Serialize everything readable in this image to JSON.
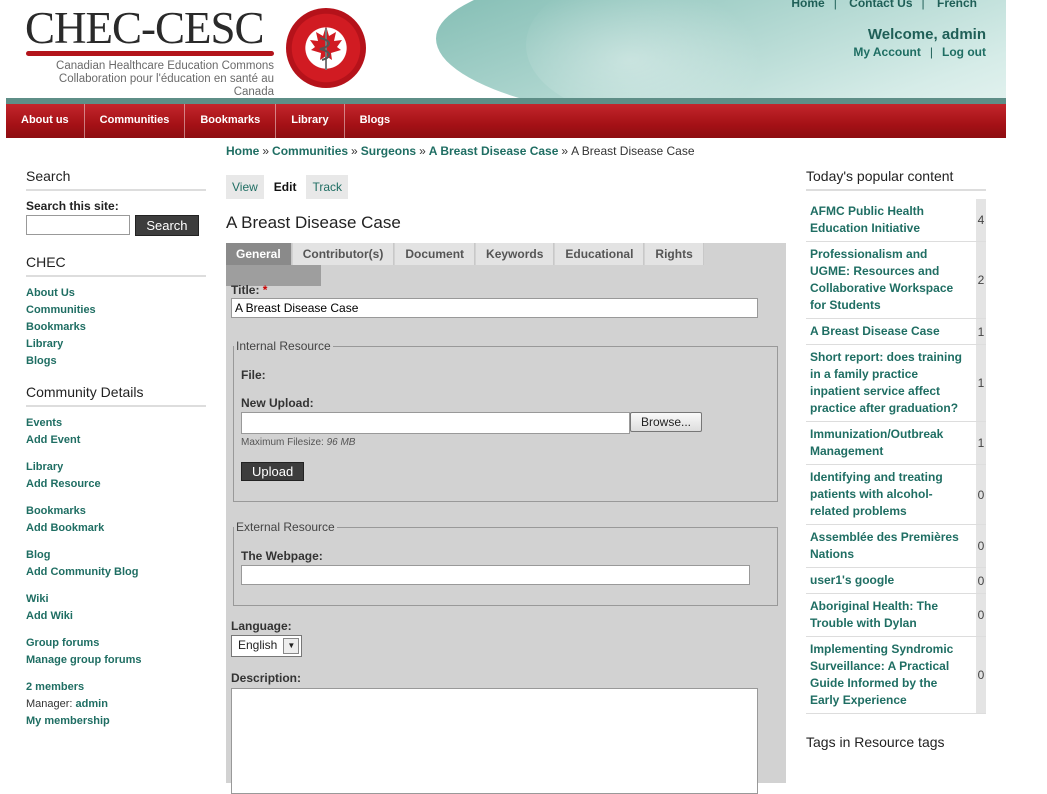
{
  "header": {
    "logo_text": "CHEC-CESC",
    "logo_sub_en": "Canadian Healthcare Education Commons",
    "logo_sub_fr": "Collaboration pour l'éducation en santé au Canada",
    "top_links": [
      "Home",
      "Contact Us",
      "French"
    ],
    "welcome": "Welcome, admin",
    "my_account": "My Account",
    "logout": "Log out"
  },
  "nav": [
    "About us",
    "Communities",
    "Bookmarks",
    "Library",
    "Blogs"
  ],
  "search": {
    "title": "Search",
    "label": "Search this site:",
    "value": "",
    "button": "Search"
  },
  "chec": {
    "title": "CHEC",
    "links": [
      "About Us",
      "Communities",
      "Bookmarks",
      "Library",
      "Blogs"
    ]
  },
  "community": {
    "title": "Community Details",
    "groups": [
      [
        "Events",
        "Add Event"
      ],
      [
        "Library",
        "Add Resource"
      ],
      [
        "Bookmarks",
        "Add Bookmark"
      ],
      [
        "Blog",
        "Add Community Blog"
      ],
      [
        "Wiki",
        "Add Wiki"
      ],
      [
        "Group forums",
        "Manage group forums"
      ]
    ],
    "members": "2 members",
    "manager_label": "Manager:",
    "manager_name": "admin",
    "membership": "My membership"
  },
  "breadcrumb": {
    "items": [
      "Home",
      "Communities",
      "Surgeons",
      "A Breast Disease Case"
    ],
    "current": "A Breast Disease Case",
    "sep": "»"
  },
  "tabs": [
    "View",
    "Edit",
    "Track"
  ],
  "active_tab": "Edit",
  "page_title": "A Breast Disease Case",
  "form": {
    "tabs": [
      "General",
      "Contributor(s)",
      "Document",
      "Keywords",
      "Educational",
      "Rights"
    ],
    "active": "General",
    "title_label": "Title:",
    "required_mark": "*",
    "title_value": "A Breast Disease Case",
    "internal_legend": "Internal Resource",
    "file_label": "File:",
    "new_upload_label": "New Upload:",
    "browse": "Browse...",
    "max_label": "Maximum Filesize:",
    "max_value": "96 MB",
    "upload": "Upload",
    "external_legend": "External Resource",
    "webpage_label": "The Webpage:",
    "webpage_value": "",
    "language_label": "Language:",
    "language_value": "English",
    "description_label": "Description:",
    "description_value": ""
  },
  "popular": {
    "title": "Today's popular content",
    "items": [
      {
        "title": "AFMC Public Health Education Initiative",
        "count": "4"
      },
      {
        "title": "Professionalism and UGME: Resources and Collaborative Workspace for Students",
        "count": "2"
      },
      {
        "title": "A Breast Disease Case",
        "count": "1"
      },
      {
        "title": "Short report: does training in a family practice inpatient service affect practice after graduation?",
        "count": "1"
      },
      {
        "title": "Immunization/Outbreak Management",
        "count": "1"
      },
      {
        "title": "Identifying and treating patients with alcohol-related problems",
        "count": "0"
      },
      {
        "title": "Assemblée des Premières Nations",
        "count": "0"
      },
      {
        "title": "user1's google",
        "count": "0"
      },
      {
        "title": "Aboriginal Health: The Trouble with Dylan",
        "count": "0"
      },
      {
        "title": "Implementing Syndromic Surveillance: A Practical Guide Informed by the Early Experience",
        "count": "0"
      }
    ]
  },
  "tags_title": "Tags in Resource tags",
  "colors": {
    "brand_red": "#a51116",
    "link_green": "#1f6e63",
    "accent_teal": "#7ab8ae"
  }
}
